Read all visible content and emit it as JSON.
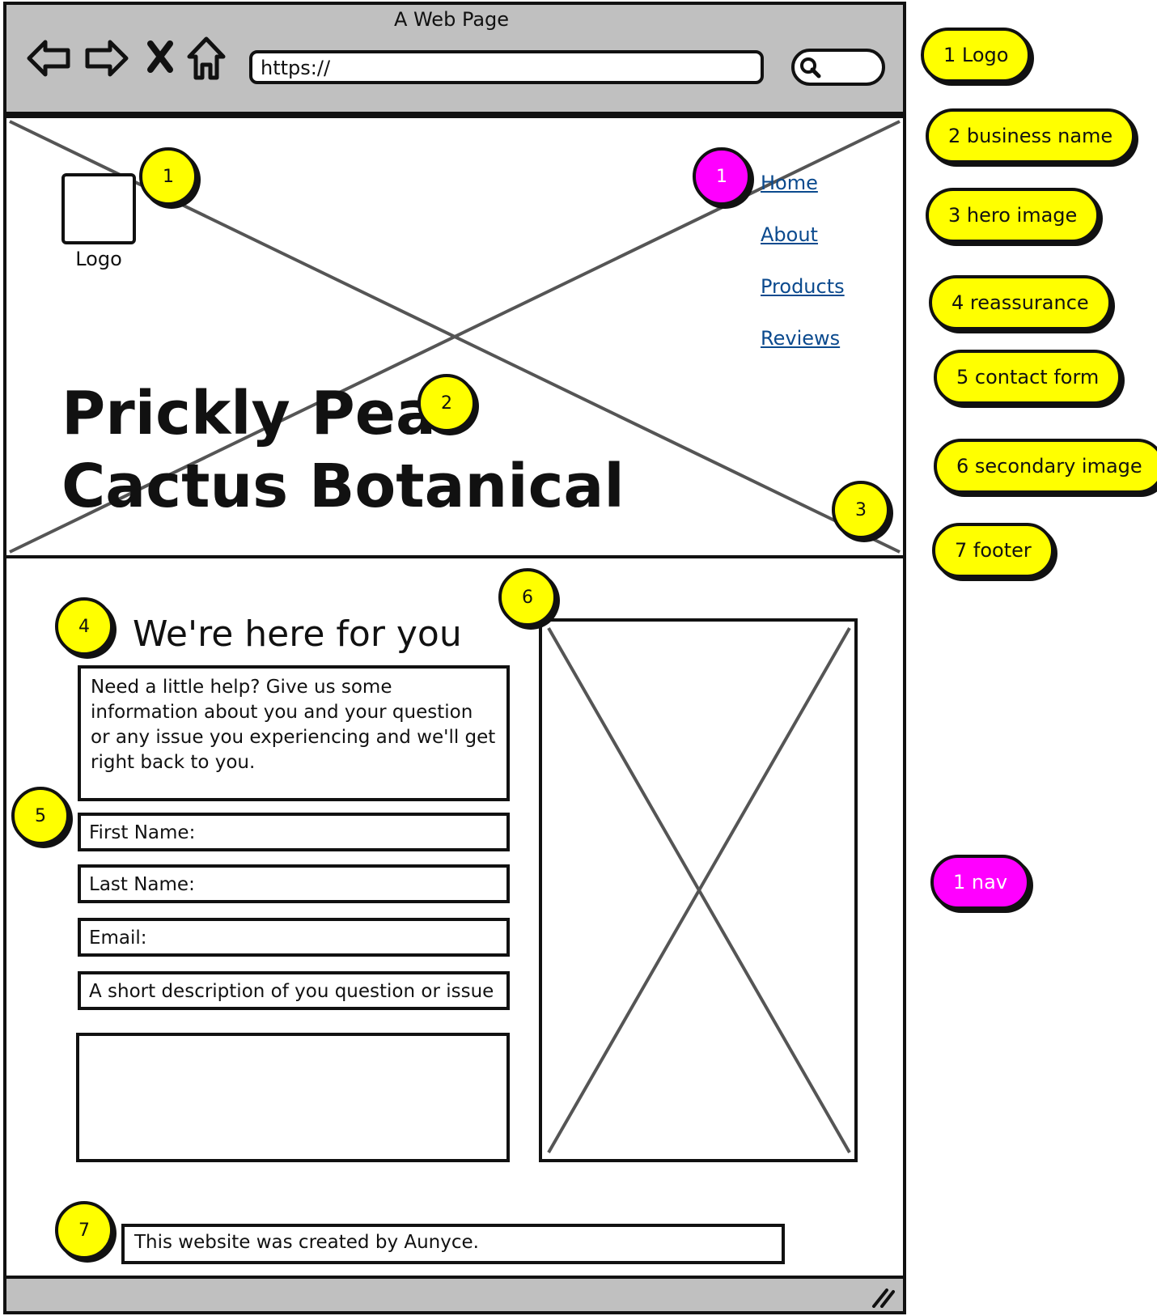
{
  "browser": {
    "title": "A Web Page",
    "url": "https://",
    "nav_icons": [
      "back-arrow-icon",
      "forward-arrow-icon",
      "close-icon",
      "home-icon",
      "search-icon"
    ]
  },
  "hero": {
    "logo_label": "Logo",
    "nav": [
      "Home",
      "About",
      "Products",
      "Reviews"
    ],
    "business_name_line1": "Prickly Pear",
    "business_name_line2": "Cactus Botanical"
  },
  "reassurance": {
    "title": "We're here for you",
    "text": "Need a little help? Give us some information about you and your question or any issue you experiencing and we'll get right back to you."
  },
  "form": {
    "first_name": "First Name:",
    "last_name": "Last Name:",
    "email": "Email:",
    "description": "A short description of you question or issue"
  },
  "footer": {
    "text": "This website was created by Aunyce."
  },
  "badges": {
    "logo": "1",
    "nav": "1",
    "business_name": "2",
    "hero_image": "3",
    "reassurance": "4",
    "contact_form": "5",
    "secondary_image": "6",
    "footer": "7"
  },
  "legend": [
    "1 Logo",
    "2 business name",
    "3 hero image",
    "4 reassurance",
    "5 contact form",
    "6 secondary image",
    "7 footer",
    "1 nav"
  ],
  "colors": {
    "badge_yellow": "#ffff00",
    "badge_pink": "#ff00ff",
    "chrome_gray": "#c0c0c0",
    "link_blue": "#0b4a8e"
  }
}
